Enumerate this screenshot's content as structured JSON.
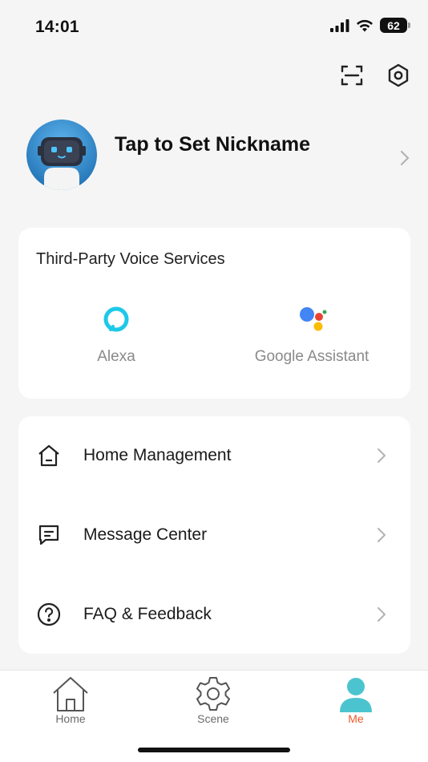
{
  "status_bar": {
    "time": "14:01",
    "battery": "62"
  },
  "top_actions": {
    "scan_icon": "scan-icon",
    "settings_icon": "settings-icon"
  },
  "profile": {
    "nickname": "Tap to Set Nickname",
    "avatar_icon": "robot-avatar-icon"
  },
  "voice_services": {
    "title": "Third-Party Voice Services",
    "items": [
      {
        "label": "Alexa",
        "icon": "alexa-icon"
      },
      {
        "label": "Google Assistant",
        "icon": "google-assistant-icon"
      }
    ]
  },
  "menu": {
    "items": [
      {
        "label": "Home Management",
        "icon": "house-icon"
      },
      {
        "label": "Message Center",
        "icon": "message-icon"
      },
      {
        "label": "FAQ & Feedback",
        "icon": "help-icon"
      }
    ]
  },
  "tabbar": {
    "tabs": [
      {
        "label": "Home",
        "icon": "home-icon",
        "active": false
      },
      {
        "label": "Scene",
        "icon": "gear-icon",
        "active": false
      },
      {
        "label": "Me",
        "icon": "person-icon",
        "active": true
      }
    ],
    "active_color": "#f0582a"
  },
  "colors": {
    "accent": "#f0582a",
    "avatar_blue": "#2d8fd5",
    "alexa": "#1ec8e8"
  }
}
